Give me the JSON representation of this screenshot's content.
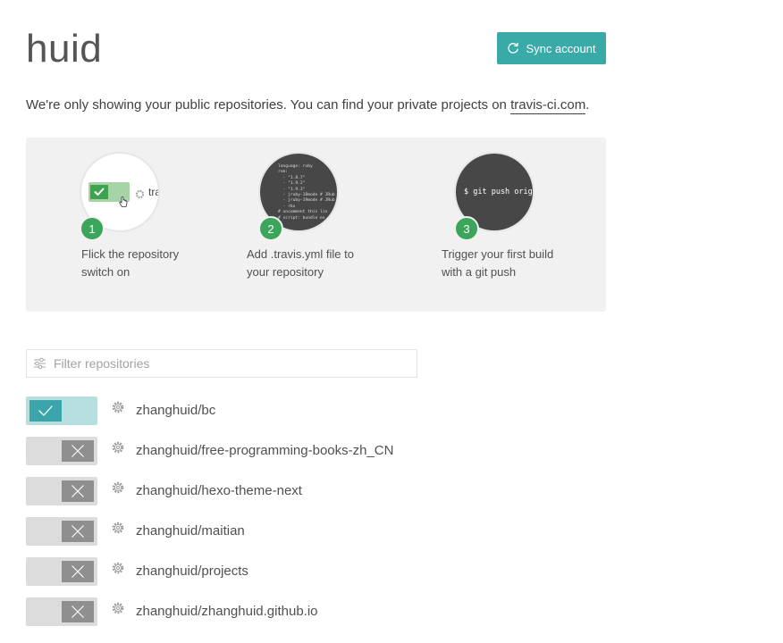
{
  "header": {
    "title": "huid",
    "sync_button_label": "Sync account"
  },
  "notice": {
    "text": "We're only showing your public repositories. You can find your private projects on ",
    "link_text": "travis-ci.com",
    "trailing": "."
  },
  "steps": [
    {
      "number": "1",
      "text": "Flick the repository switch on",
      "illustration_text": "tra"
    },
    {
      "number": "2",
      "text": "Add .travis.yml file to your repository",
      "illustration_code": "language: ruby\nrvm:\n  - \"1.8.7\"\n  - \"1.9.2\"\n  - \"1.9.3\"\n  - jruby-18mode # JRub\n  - jruby-19mode # JRub\n  - rbx\n# uncomment this lin\n# script: bundle ex"
    },
    {
      "number": "3",
      "text": "Trigger your first build with a git push",
      "illustration_text": "$ git push origin"
    }
  ],
  "filter": {
    "placeholder": "Filter repositories",
    "value": ""
  },
  "repositories": [
    {
      "name": "zhanghuid/bc",
      "active": true
    },
    {
      "name": "zhanghuid/free-programming-books-zh_CN",
      "active": false
    },
    {
      "name": "zhanghuid/hexo-theme-next",
      "active": false
    },
    {
      "name": "zhanghuid/maitian",
      "active": false
    },
    {
      "name": "zhanghuid/projects",
      "active": false
    },
    {
      "name": "zhanghuid/zhanghuid.github.io",
      "active": false
    }
  ],
  "icons": {
    "sync": "refresh-icon",
    "filter": "sliders-icon",
    "settings": "gear-icon",
    "switch_on": "check-icon",
    "switch_off": "x-icon",
    "cursor": "hand-pointer-icon"
  },
  "colors": {
    "accent": "#39aaa8",
    "step_badge": "#3ba55c",
    "switch_on_track": "#b7dfe0",
    "switch_on_knob": "#3ba5ab",
    "switch_off_track": "#dcdcdc",
    "switch_off_knob": "#8f8f8f"
  }
}
